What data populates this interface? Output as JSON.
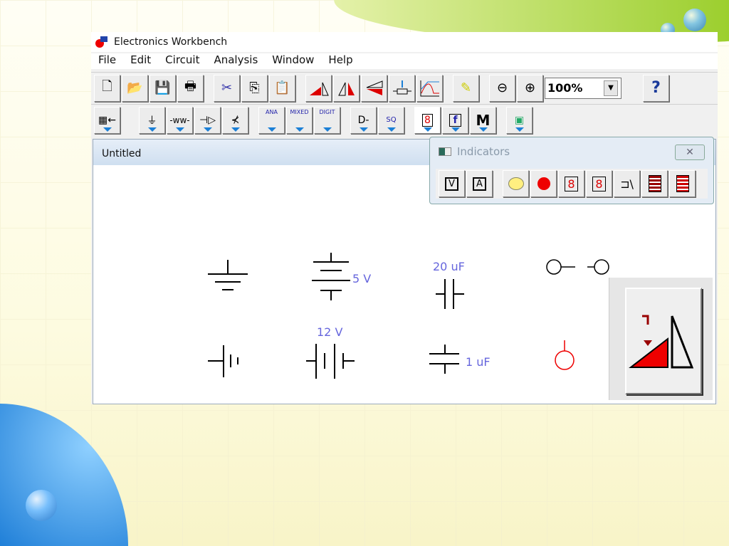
{
  "app": {
    "title": "Electronics Workbench"
  },
  "menu": [
    "File",
    "Edit",
    "Circuit",
    "Analysis",
    "Window",
    "Help"
  ],
  "toolbar": {
    "zoom_value": "100%",
    "help_label": "?",
    "bins": {
      "ana": "ANA",
      "mixed": "MIXED",
      "digit": "DIGIT",
      "misc": "M",
      "func": "f"
    }
  },
  "document": {
    "title": "Untitled"
  },
  "indicators": {
    "title": "Indicators",
    "voltmeter": "V",
    "ammeter": "A"
  },
  "canvas": {
    "c1": "20 uF",
    "v1": "5 V",
    "v2": "12 V",
    "c2": "1 uF"
  },
  "colors": {
    "accent": "#1b7fd6",
    "red": "#e00000",
    "label": "#6666dd"
  }
}
